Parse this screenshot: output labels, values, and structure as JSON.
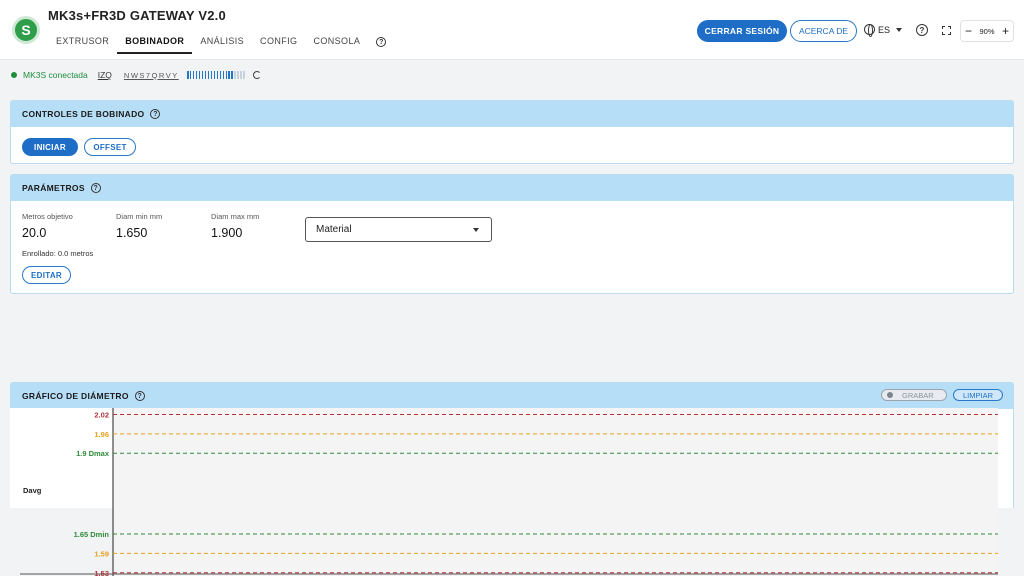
{
  "app": {
    "title": "MK3s+FR3D GATEWAY V2.0"
  },
  "nav": {
    "tabs": [
      {
        "label": "EXTRUSOR",
        "active": false
      },
      {
        "label": "BOBINADOR",
        "active": true
      },
      {
        "label": "ANÁLISIS",
        "active": false
      },
      {
        "label": "CONFIG",
        "active": false
      },
      {
        "label": "CONSOLA",
        "active": false
      }
    ]
  },
  "header": {
    "logout_label": "CERRAR SESIÓN",
    "about_label": "ACERCA DE",
    "language": "ES",
    "zoom": "90%",
    "zoom_minus": "−",
    "zoom_plus": "+"
  },
  "status": {
    "connection": "MK3S conectada",
    "side": "IZQ",
    "serial": "NWS7QRVY",
    "signal_level": 0.8
  },
  "winding_controls": {
    "title": "CONTROLES DE BOBINADO",
    "start_label": "INICIAR",
    "offset_label": "OFFSET"
  },
  "parameters": {
    "title": "PARÁMETROS",
    "target_meters": {
      "label": "Metros objetivo",
      "value": "20.0"
    },
    "diam_min": {
      "label": "Diam min mm",
      "value": "1.650"
    },
    "diam_max": {
      "label": "Diam max mm",
      "value": "1.900"
    },
    "material": {
      "label": "Material"
    },
    "rolled": "Enrollado: 0.0 metros",
    "edit_label": "EDITAR"
  },
  "diameter_chart": {
    "title": "GRÁFICO DE DIÁMETRO",
    "record_label": "GRABAR",
    "clear_label": "LIMPIAR",
    "y_axis_label": "Davg"
  },
  "colors": {
    "accent": "#1e6ec8",
    "header_band": "#b7def7",
    "connected": "#1e8e3e",
    "limit_red": "#b5333b",
    "limit_orange": "#e6a11b",
    "limit_green": "#2e8b3a"
  },
  "chart_data": {
    "type": "line",
    "title": "GRÁFICO DE DIÁMETRO",
    "ylabel": "Davg",
    "xlabel": "",
    "ylim": [
      1.52,
      2.04
    ],
    "series": [],
    "reference_lines": [
      {
        "label": "2.02",
        "y": 2.02,
        "color": "#b5333b"
      },
      {
        "label": "1.96",
        "y": 1.96,
        "color": "#e6a11b"
      },
      {
        "label": "1.9 Dmax",
        "y": 1.9,
        "color": "#2e8b3a"
      },
      {
        "label": "1.65 Dmin",
        "y": 1.65,
        "color": "#2e8b3a"
      },
      {
        "label": "1.59",
        "y": 1.59,
        "color": "#e6a11b"
      },
      {
        "label": "1.53",
        "y": 1.53,
        "color": "#b5333b"
      }
    ]
  }
}
